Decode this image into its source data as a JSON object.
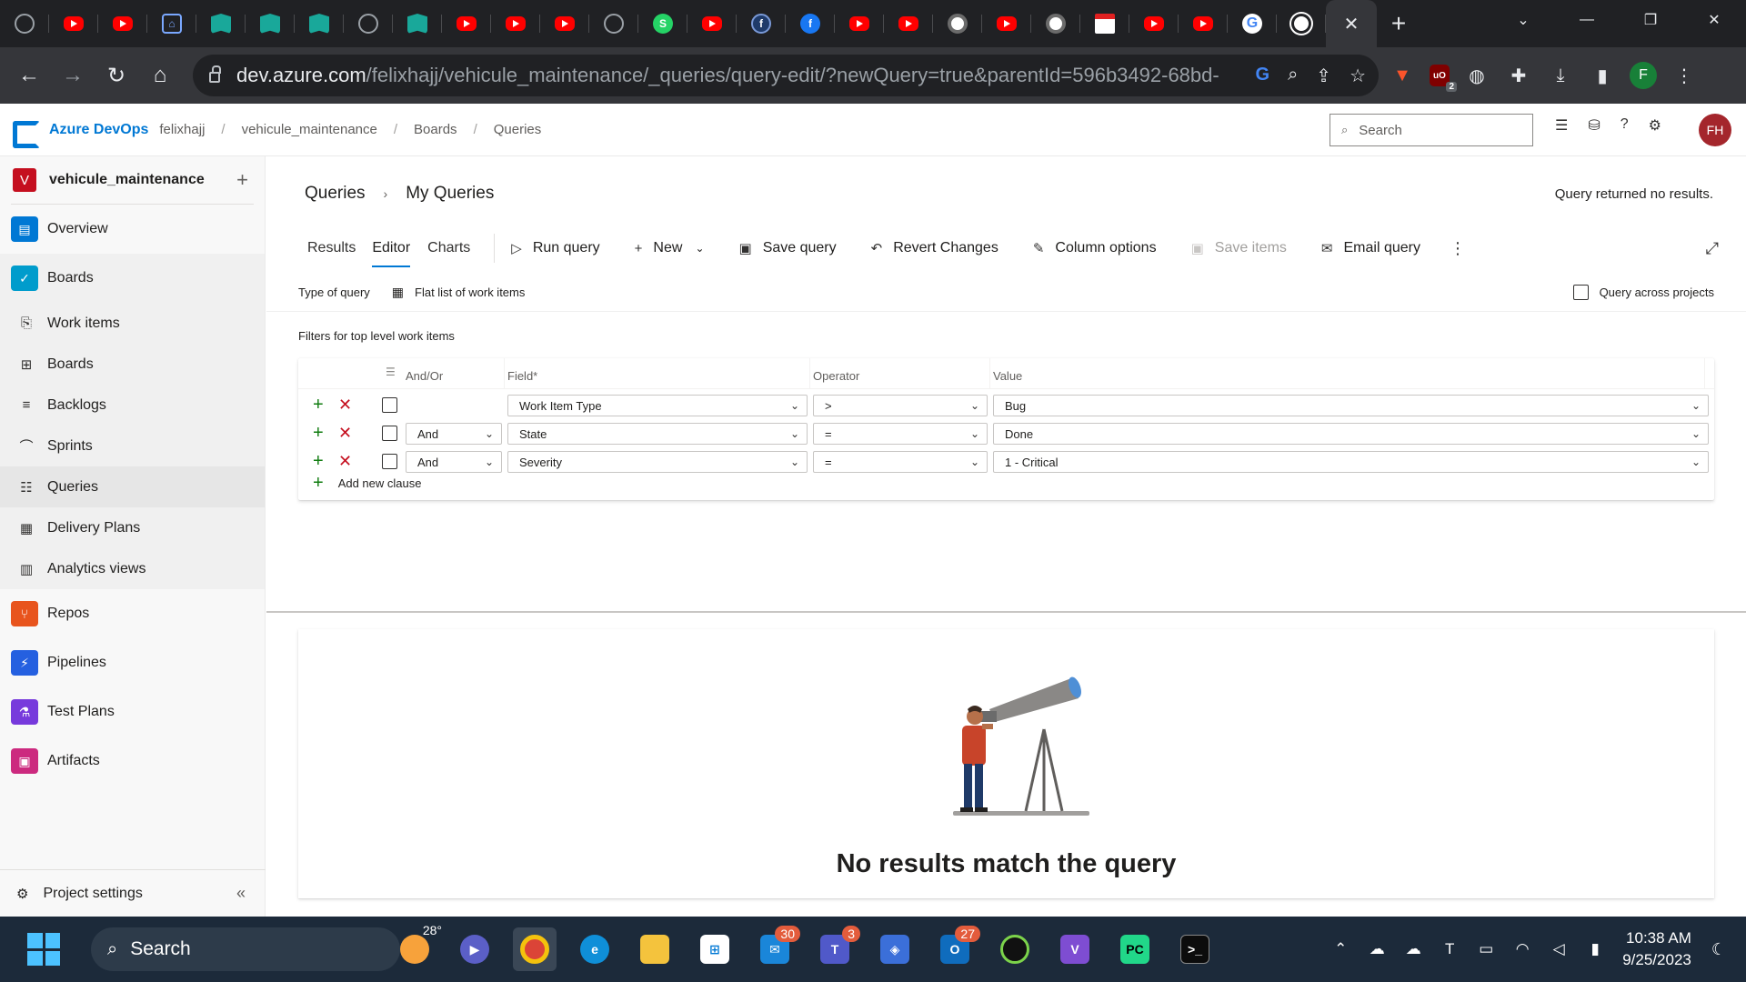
{
  "browser": {
    "tabs": [
      {
        "icon": "chatgpt-icon"
      },
      {
        "icon": "youtube-icon"
      },
      {
        "icon": "youtube-icon"
      },
      {
        "icon": "bank-icon"
      },
      {
        "icon": "book-icon"
      },
      {
        "icon": "book-icon"
      },
      {
        "icon": "book-icon"
      },
      {
        "icon": "openai-icon"
      },
      {
        "icon": "book-icon"
      },
      {
        "icon": "youtube-icon"
      },
      {
        "icon": "youtube-icon"
      },
      {
        "icon": "youtube-icon"
      },
      {
        "icon": "openai-icon"
      },
      {
        "icon": "whatsapp-icon"
      },
      {
        "icon": "youtube-icon"
      },
      {
        "icon": "facebook-icon"
      },
      {
        "icon": "facebook-icon"
      },
      {
        "icon": "youtube-icon"
      },
      {
        "icon": "youtube-icon"
      },
      {
        "icon": "chrome-icon"
      },
      {
        "icon": "youtube-icon"
      },
      {
        "icon": "chrome-icon"
      },
      {
        "icon": "page-icon"
      },
      {
        "icon": "youtube-icon"
      },
      {
        "icon": "youtube-icon"
      },
      {
        "icon": "google-icon"
      },
      {
        "icon": "github-icon"
      }
    ],
    "url_host": "dev.azure.com",
    "url_path": "/felixhajj/vehicule_maintenance/_queries/query-edit/?newQuery=true&parentId=596b3492-68bd-...",
    "profile_initial": "F",
    "ublock_count": "2",
    "ublock_label": "uO"
  },
  "header": {
    "brand": "Azure DevOps",
    "breadcrumb": [
      "felixhajj",
      "vehicule_maintenance",
      "Boards",
      "Queries"
    ],
    "search_placeholder": "Search",
    "avatar_initials": "FH"
  },
  "sidebar": {
    "project_initial": "V",
    "project_name": "vehicule_maintenance",
    "items": [
      {
        "label": "Overview"
      },
      {
        "label": "Boards"
      },
      {
        "label": "Work items"
      },
      {
        "label": "Boards"
      },
      {
        "label": "Backlogs"
      },
      {
        "label": "Sprints"
      },
      {
        "label": "Queries"
      },
      {
        "label": "Delivery Plans"
      },
      {
        "label": "Analytics views"
      },
      {
        "label": "Repos"
      },
      {
        "label": "Pipelines"
      },
      {
        "label": "Test Plans"
      },
      {
        "label": "Artifacts"
      }
    ],
    "settings_label": "Project settings"
  },
  "main": {
    "breadcrumb_root": "Queries",
    "breadcrumb_current": "My Queries",
    "status_message": "Query returned no results.",
    "tabs": [
      {
        "label": "Results"
      },
      {
        "label": "Editor"
      },
      {
        "label": "Charts"
      }
    ],
    "commands": {
      "run": "Run query",
      "new": "New",
      "save": "Save query",
      "revert": "Revert Changes",
      "columns": "Column options",
      "save_items": "Save items",
      "email": "Email query"
    },
    "type_of_query_label": "Type of query",
    "type_of_query_value": "Flat list of work items",
    "query_across_label": "Query across projects",
    "filters_label": "Filters for top level work items",
    "columns": {
      "andor": "And/Or",
      "field": "Field*",
      "operator": "Operator",
      "value": "Value"
    },
    "clauses": [
      {
        "andor": "",
        "field": "Work Item Type",
        "operator": ">",
        "value": "Bug"
      },
      {
        "andor": "And",
        "field": "State",
        "operator": "=",
        "value": "Done"
      },
      {
        "andor": "And",
        "field": "Severity",
        "operator": "=",
        "value": "1 - Critical"
      }
    ],
    "add_clause_label": "Add new clause",
    "empty_title": "No results match the query"
  },
  "taskbar": {
    "search_label": "Search",
    "weather": "28°",
    "mail_badge": "30",
    "teams_badge": "3",
    "outlook_badge": "27",
    "time": "10:38 AM",
    "date": "9/25/2023"
  },
  "colors": {
    "accent": "#0078d4",
    "add": "#107c10",
    "delete": "#c50f1f",
    "avatar": "#a4262c"
  }
}
